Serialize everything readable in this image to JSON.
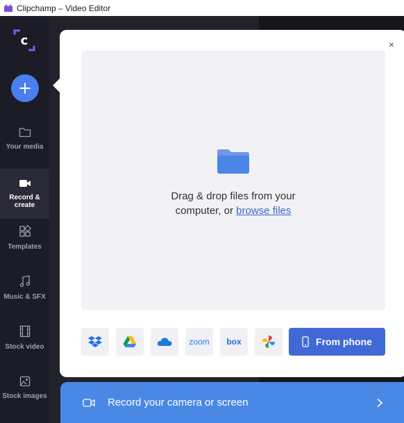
{
  "window": {
    "title": "Clipchamp – Video Editor"
  },
  "logo": {
    "letter": "c"
  },
  "sidebar": {
    "items": [
      {
        "label": "Your media",
        "icon": "folder-icon"
      },
      {
        "label": "Record & create",
        "icon": "video-camera-icon",
        "active": true
      },
      {
        "label": "Templates",
        "icon": "templates-icon"
      },
      {
        "label": "Music & SFX",
        "icon": "music-note-icon"
      },
      {
        "label": "Stock video",
        "icon": "film-icon"
      },
      {
        "label": "Stock images",
        "icon": "image-icon"
      }
    ]
  },
  "import_panel": {
    "close_label": "×",
    "drop_text_line1": "Drag & drop files from your",
    "drop_text_line2_prefix": "computer, or ",
    "browse_link": "browse files",
    "sources": [
      {
        "id": "dropbox",
        "icon": "dropbox-icon"
      },
      {
        "id": "google-drive",
        "icon": "google-drive-icon"
      },
      {
        "id": "onedrive",
        "icon": "onedrive-icon"
      },
      {
        "id": "zoom",
        "label": "zoom"
      },
      {
        "id": "box",
        "label": "box"
      },
      {
        "id": "google-photos",
        "icon": "google-photos-icon"
      }
    ],
    "phone_button": "From phone"
  },
  "record_bar": {
    "label": "Record your camera or screen"
  },
  "colors": {
    "accent": "#4a7ff0",
    "phone_button": "#4169d6",
    "record_bar": "#4a88e6",
    "sidebar": "#1c1c26"
  }
}
